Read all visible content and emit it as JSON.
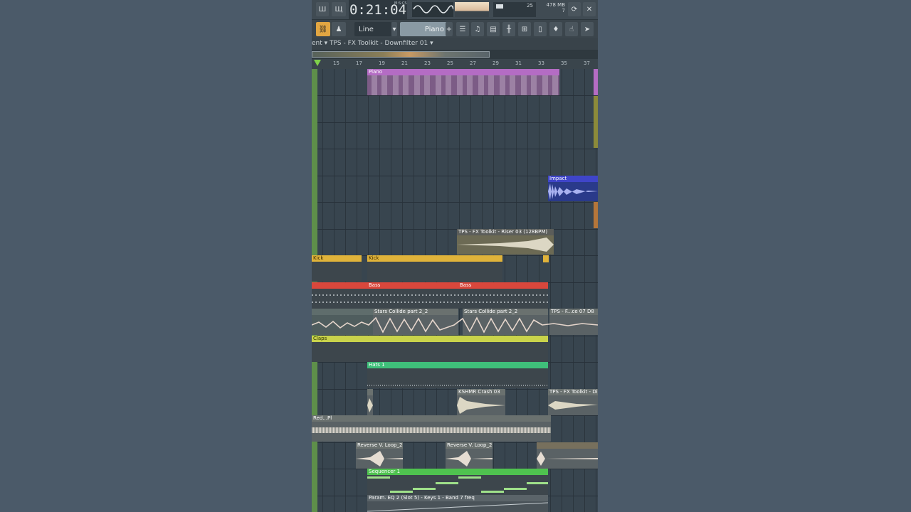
{
  "toolbar": {
    "time": "0:21:04",
    "time_unit": "M:S:CS",
    "snap_mode": "Line",
    "pattern": "Piano",
    "cpu": "25",
    "memory": "478 MB",
    "voices": "7"
  },
  "window_title": "ent ▾  TPS - FX Toolkit - Downfilter 01 ▾",
  "ruler_ticks": [
    "15",
    "17",
    "19",
    "21",
    "23",
    "25",
    "27",
    "29",
    "31",
    "33",
    "35",
    "37"
  ],
  "clips": {
    "piano": "Piano",
    "impact": "Impact",
    "riser": "TPS - FX Toolkit - Riser 03 (128BPM)",
    "kick": "Kick",
    "bass": "Bass",
    "stars": "Stars Collide part 2_2",
    "fx_right": "TPS - F...ce 07 D8",
    "claps": "Claps",
    "hats": "Hats 1",
    "crash": "KSHMR Crash 03",
    "tps_right": "TPS - FX Toolkit - Di",
    "red": "Red...Pl",
    "reverse": "Reverse V. Loop_2",
    "sequencer": "Sequencer 1",
    "param": "Param. EQ 2 (Slot 5) - Keys 1 - Band 7 freq"
  },
  "colors": {
    "piano": "#b46cc4",
    "impact": "#3f45c9",
    "kick": "#e0b33a",
    "bass": "#d9473c",
    "claps": "#c9d34b",
    "hats": "#3fbf7a",
    "sequencer": "#4fc24f"
  }
}
